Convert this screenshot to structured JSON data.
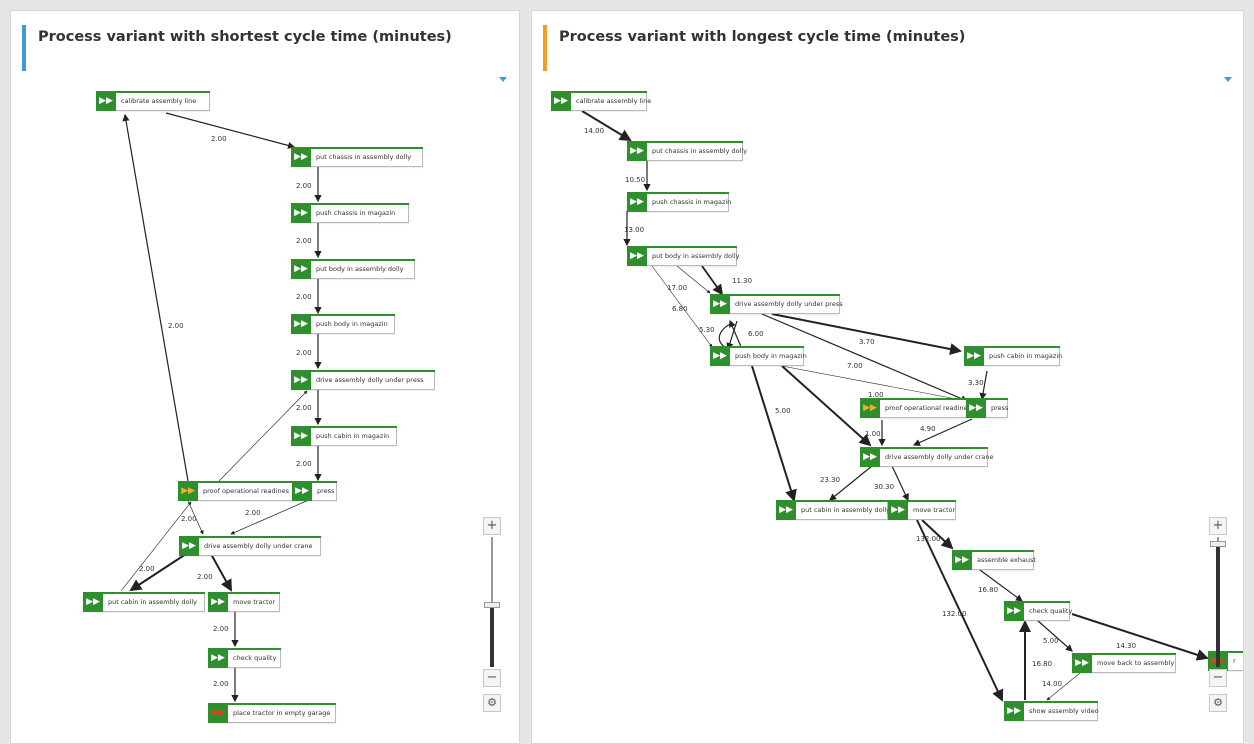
{
  "left_panel": {
    "title": "Process variant with shortest cycle time (minutes)",
    "accent_color": "#3a9fd8",
    "nodes": [
      {
        "id": "calibrate",
        "label": "calibrate assembly line",
        "kind": "normal"
      },
      {
        "id": "put_chassis",
        "label": "put chassis in assembly dolly",
        "kind": "normal"
      },
      {
        "id": "push_chassis",
        "label": "push chassis in magazin",
        "kind": "normal"
      },
      {
        "id": "put_body",
        "label": "put body in assembly dolly",
        "kind": "normal"
      },
      {
        "id": "push_body",
        "label": "push body in magazin",
        "kind": "normal"
      },
      {
        "id": "drive_press",
        "label": "drive assembly dolly under press",
        "kind": "normal"
      },
      {
        "id": "push_cabin",
        "label": "push cabin in magazin",
        "kind": "normal"
      },
      {
        "id": "proof",
        "label": "proof operational readines",
        "kind": "start"
      },
      {
        "id": "press",
        "label": "press",
        "kind": "normal"
      },
      {
        "id": "drive_crane",
        "label": "drive assembly dolly under crane",
        "kind": "normal"
      },
      {
        "id": "put_cabin",
        "label": "put cabin in assembly dolly",
        "kind": "normal"
      },
      {
        "id": "move_tractor",
        "label": "move tractor",
        "kind": "normal"
      },
      {
        "id": "check_quality",
        "label": "check quality",
        "kind": "normal"
      },
      {
        "id": "place_tractor",
        "label": "place tractor in empty garage",
        "kind": "end"
      }
    ],
    "edges": [
      {
        "from": "calibrate",
        "to": "put_chassis",
        "label": "2.00"
      },
      {
        "from": "put_chassis",
        "to": "push_chassis",
        "label": "2.00"
      },
      {
        "from": "push_chassis",
        "to": "put_body",
        "label": "2.00"
      },
      {
        "from": "put_body",
        "to": "push_body",
        "label": "2.00"
      },
      {
        "from": "push_body",
        "to": "drive_press",
        "label": "2.00"
      },
      {
        "from": "drive_press",
        "to": "push_cabin",
        "label": "2.00"
      },
      {
        "from": "push_cabin",
        "to": "press",
        "label": "2.00"
      },
      {
        "from": "proof",
        "to": "calibrate",
        "label": "2.00"
      },
      {
        "from": "press",
        "to": "drive_crane",
        "label": "2.00"
      },
      {
        "from": "proof",
        "to": "drive_crane",
        "label": "2.00"
      },
      {
        "from": "proof",
        "to": "drive_press",
        "label": ""
      },
      {
        "from": "drive_crane",
        "to": "put_cabin",
        "label": "2.00"
      },
      {
        "from": "put_cabin",
        "to": "proof",
        "label": ""
      },
      {
        "from": "drive_crane",
        "to": "move_tractor",
        "label": "2.00"
      },
      {
        "from": "move_tractor",
        "to": "check_quality",
        "label": "2.00"
      },
      {
        "from": "check_quality",
        "to": "place_tractor",
        "label": "2.00"
      }
    ],
    "zoom_level": 0.32
  },
  "right_panel": {
    "title": "Process variant with longest cycle time (minutes)",
    "accent_color": "#f0a020",
    "nodes": [
      {
        "id": "calibrate",
        "label": "calibrate assembly line",
        "kind": "normal"
      },
      {
        "id": "put_chassis",
        "label": "put chassis in assembly dolly",
        "kind": "normal"
      },
      {
        "id": "push_chassis",
        "label": "push chassis in magazin",
        "kind": "normal"
      },
      {
        "id": "put_body",
        "label": "put body in assembly dolly",
        "kind": "normal"
      },
      {
        "id": "drive_press",
        "label": "drive assembly dolly under press",
        "kind": "normal"
      },
      {
        "id": "push_body",
        "label": "push body in magazin",
        "kind": "normal"
      },
      {
        "id": "push_cabin",
        "label": "push cabin in magazin",
        "kind": "normal"
      },
      {
        "id": "proof",
        "label": "proof operational readines",
        "kind": "start"
      },
      {
        "id": "press",
        "label": "press",
        "kind": "normal"
      },
      {
        "id": "drive_crane",
        "label": "drive assembly dolly under crane",
        "kind": "normal"
      },
      {
        "id": "put_cabin",
        "label": "put cabin in assembly dolly",
        "kind": "normal"
      },
      {
        "id": "move_tractor",
        "label": "move tractor",
        "kind": "normal"
      },
      {
        "id": "assemble_exhaust",
        "label": "assemble exhaust",
        "kind": "normal"
      },
      {
        "id": "check_quality",
        "label": "check quality",
        "kind": "normal"
      },
      {
        "id": "move_back",
        "label": "move back to assembly",
        "kind": "normal"
      },
      {
        "id": "show_video",
        "label": "show assembly video",
        "kind": "normal"
      },
      {
        "id": "cut",
        "label": "r",
        "kind": "end"
      }
    ],
    "edges": [
      {
        "from": "calibrate",
        "to": "put_chassis",
        "label": "14.00"
      },
      {
        "from": "put_chassis",
        "to": "push_chassis",
        "label": "10.50"
      },
      {
        "from": "push_chassis",
        "to": "put_body",
        "label": "13.00"
      },
      {
        "from": "put_body",
        "to": "drive_press",
        "label": "11.30"
      },
      {
        "from": "put_body",
        "to": "drive_press",
        "label": "17.00"
      },
      {
        "from": "put_body",
        "to": "push_body",
        "label": "6.80"
      },
      {
        "from": "drive_press",
        "to": "push_body",
        "label": "5.30"
      },
      {
        "from": "push_body",
        "to": "drive_press",
        "label": "6.00"
      },
      {
        "from": "drive_press",
        "to": "push_cabin",
        "label": "3.70"
      },
      {
        "from": "drive_press",
        "to": "press",
        "label": "7.00"
      },
      {
        "from": "push_cabin",
        "to": "press",
        "label": "3.30"
      },
      {
        "from": "push_body",
        "to": "proof",
        "label": "1.00"
      },
      {
        "from": "proof",
        "to": "drive_crane",
        "label": "1.00"
      },
      {
        "from": "press",
        "to": "drive_crane",
        "label": "4.90"
      },
      {
        "from": "push_body",
        "to": "put_cabin",
        "label": "5.00"
      },
      {
        "from": "drive_crane",
        "to": "put_cabin",
        "label": "23.30"
      },
      {
        "from": "drive_crane",
        "to": "move_tractor",
        "label": "30.30"
      },
      {
        "from": "move_tractor",
        "to": "assemble_exhaust",
        "label": "132.00"
      },
      {
        "from": "move_tractor",
        "to": "show_video",
        "label": "132.00"
      },
      {
        "from": "assemble_exhaust",
        "to": "check_quality",
        "label": "16.80"
      },
      {
        "from": "check_quality",
        "to": "move_back",
        "label": "5.00"
      },
      {
        "from": "check_quality",
        "to": "cut",
        "label": "14.30"
      },
      {
        "from": "move_back",
        "to": "show_video",
        "label": "14.00"
      },
      {
        "from": "show_video",
        "to": "check_quality",
        "label": "16.80"
      }
    ],
    "zoom_level": 0.95
  },
  "icons": {
    "node": "fast-forward-icon",
    "caret": "caret-down-icon",
    "zoom_in": "plus-icon",
    "zoom_out": "minus-icon",
    "settings": "gear-icon"
  },
  "zoom": {
    "plus": "+",
    "minus": "−",
    "gear": "⚙"
  }
}
